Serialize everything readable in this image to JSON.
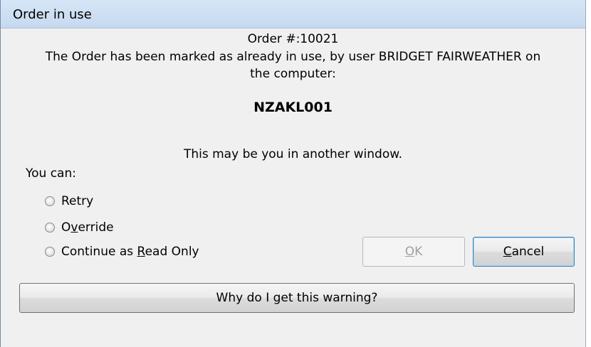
{
  "dialog": {
    "title": "Order in use",
    "order_number": "Order #:10021",
    "message_line1": "The Order has been marked as already in use, by user BRIDGET FAIRWEATHER on",
    "message_line2": "the computer:",
    "computer_name": "NZAKL001",
    "another_window": "This may be you in another window.",
    "you_can": "You can:"
  },
  "options": [
    {
      "label_pre": "Retry",
      "mnemonic": "",
      "label_post": "",
      "selected": false
    },
    {
      "label_pre": "O",
      "mnemonic": "v",
      "label_post": "erride",
      "selected": false
    },
    {
      "label_pre": "Continue as ",
      "mnemonic": "R",
      "label_post": "ead Only",
      "selected": false
    }
  ],
  "buttons": {
    "ok_mnemonic": "O",
    "ok_rest": "K",
    "ok_enabled": false,
    "cancel_mnemonic": "C",
    "cancel_rest": "ancel",
    "why": "Why do I get this warning?"
  }
}
